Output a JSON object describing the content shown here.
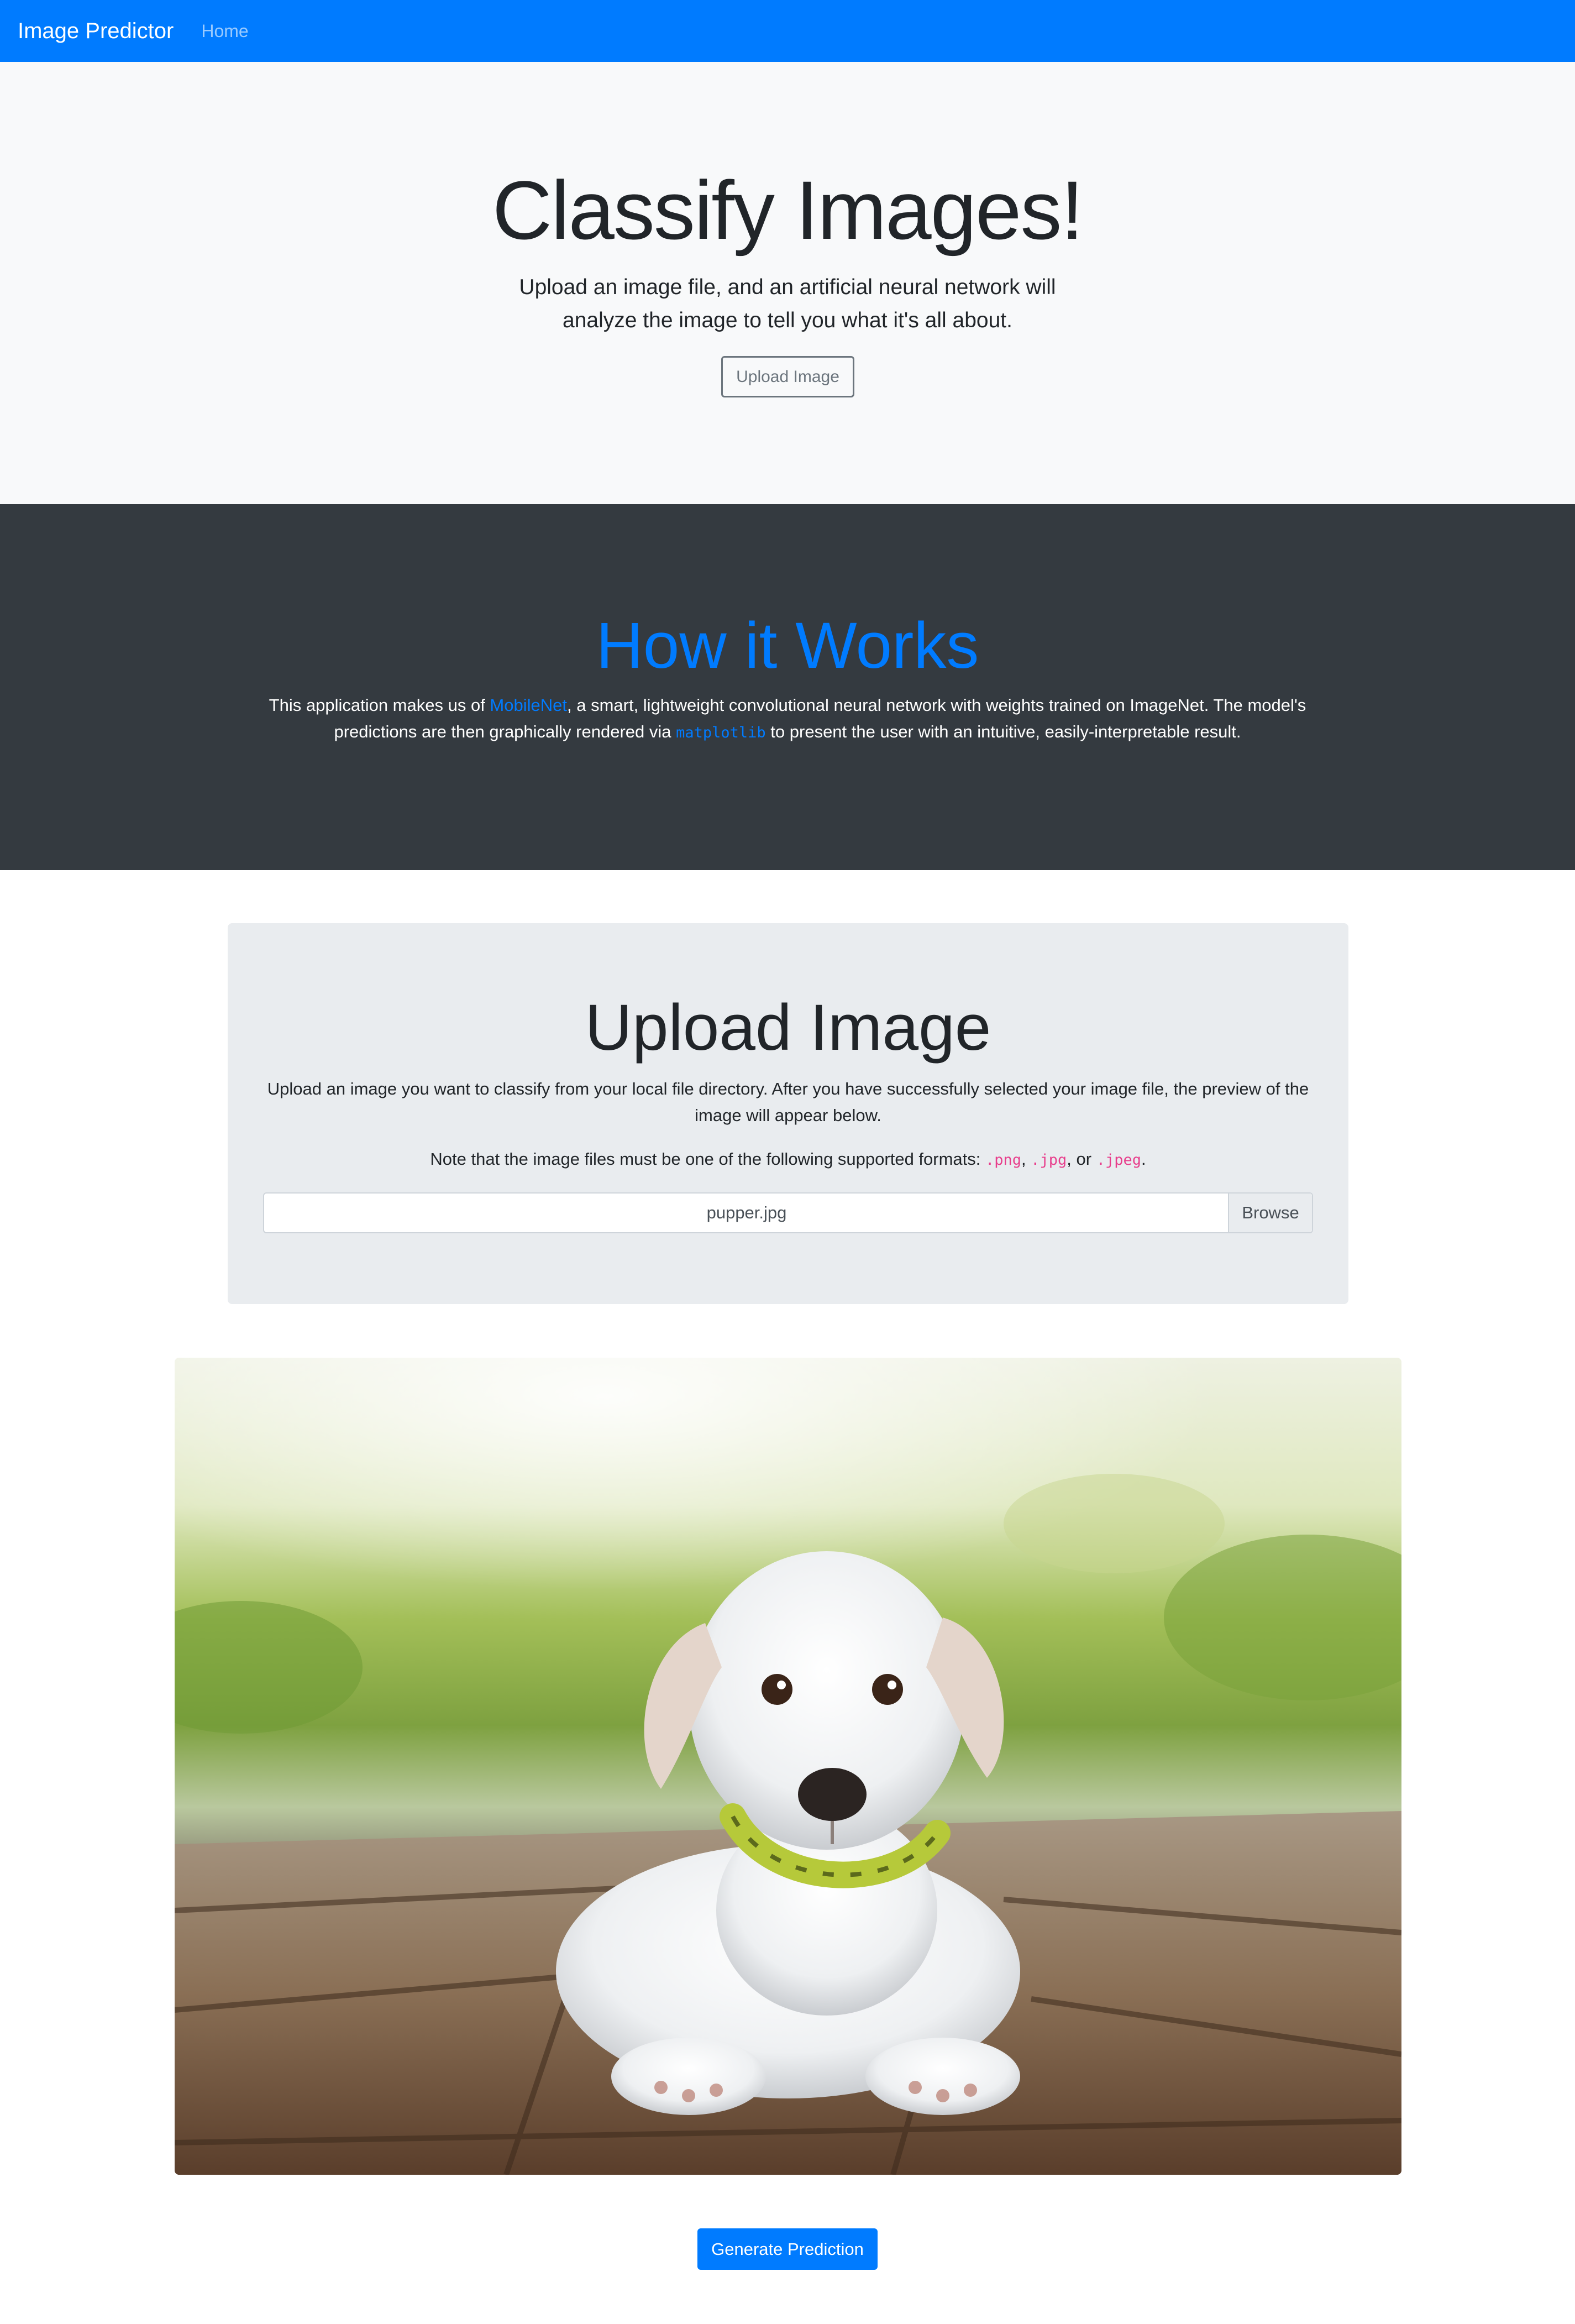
{
  "navbar": {
    "brand": "Image Predictor",
    "home_link": "Home",
    "bg_color": "#007bff"
  },
  "hero": {
    "title": "Classify Images!",
    "lead": "Upload an image file, and an artificial neural network will analyze the image to tell you what it's all about.",
    "button_label": "Upload Image"
  },
  "how": {
    "title": "How it Works",
    "text_before_link": "This application makes us of ",
    "link_text": "MobileNet",
    "text_after_link": ", a smart, lightweight convolutional neural network with weights trained on ImageNet. The model's predictions are then graphically rendered via ",
    "code_text": "matplotlib",
    "text_end": " to present the user with an intuitive, easily-interpretable result.",
    "bg_color": "#343a40",
    "title_color": "#007bff"
  },
  "upload": {
    "title": "Upload Image",
    "description": "Upload an image you want to classify from your local file directory. After you have successfully selected your image file, the preview of the image will appear below.",
    "note_prefix": "Note that the image files must be one of the following supported formats: ",
    "formats": [
      ".png",
      ".jpg",
      ".jpeg"
    ],
    "sep1": ", ",
    "sep2": ", or ",
    "note_suffix": ".",
    "file_name": "pupper.jpg",
    "browse_label": "Browse"
  },
  "preview": {
    "image_subject": "white-puppy-photo"
  },
  "actions": {
    "generate_label": "Generate Prediction"
  }
}
